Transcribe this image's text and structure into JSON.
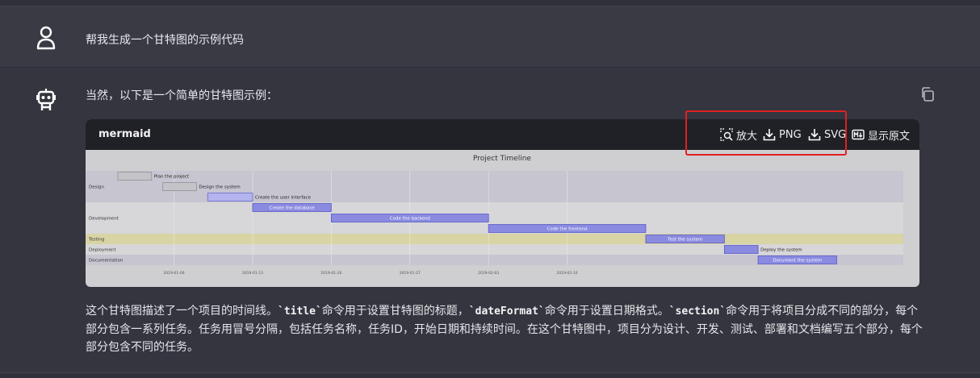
{
  "conversation": {
    "user_message": "帮我生成一个甘特图的示例代码",
    "bot_intro": "当然，以下是一个简单的甘特图示例：",
    "code_block": {
      "language_label": "mermaid",
      "tools": {
        "zoom": "放大",
        "png": "PNG",
        "svg": "SVG",
        "raw": "显示原文"
      }
    },
    "explanation": {
      "p1": "这个甘特图描述了一个项目的时间线。",
      "code1": "`title`",
      "p2": "命令用于设置甘特图的标题，",
      "code2": "`dateFormat`",
      "p3": "命令用于设置日期格式。",
      "code3": "`section`",
      "p4": "命令用于将项目分成不同的部分，每个部分包含一系列任务。任务用冒号分隔，包括任务名称，任务ID，开始日期和持续时间。在这个甘特图中，项目分为设计、开发、测试、部署和文档编写五个部分，每个部分包含不同的任务。"
    }
  },
  "chart_data": {
    "type": "gantt",
    "title": "Project Timeline",
    "sections": [
      "Design",
      "Development",
      "Testing",
      "Deployment",
      "Documentation"
    ],
    "tasks": [
      {
        "section": "Design",
        "name": "Plan the project",
        "start": "2019-01-01",
        "end": "2019-01-04"
      },
      {
        "section": "Design",
        "name": "Design the system",
        "start": "2019-01-05",
        "end": "2019-01-08"
      },
      {
        "section": "Design",
        "name": "Create the user interface",
        "start": "2019-01-09",
        "end": "2019-01-13"
      },
      {
        "section": "Development",
        "name": "Create the database",
        "start": "2019-01-13",
        "end": "2019-01-20"
      },
      {
        "section": "Development",
        "name": "Code the backend",
        "start": "2019-01-20",
        "end": "2019-02-03"
      },
      {
        "section": "Development",
        "name": "Code the frontend",
        "start": "2019-02-03",
        "end": "2019-02-17"
      },
      {
        "section": "Testing",
        "name": "Test the system",
        "start": "2019-02-17",
        "end": "2019-02-24"
      },
      {
        "section": "Deployment",
        "name": "Deploy the system",
        "start": "2019-02-24",
        "end": "2019-02-27"
      },
      {
        "section": "Documentation",
        "name": "Document the system",
        "start": "2019-02-27",
        "end": "2019-03-06"
      }
    ],
    "x_ticks": [
      "2019-01-06",
      "2019-01-13",
      "2019-01-20",
      "2019-01-27",
      "2019-02-03",
      "2019-02-10"
    ],
    "x_range": [
      "2019-01-01",
      "2019-03-12"
    ]
  }
}
